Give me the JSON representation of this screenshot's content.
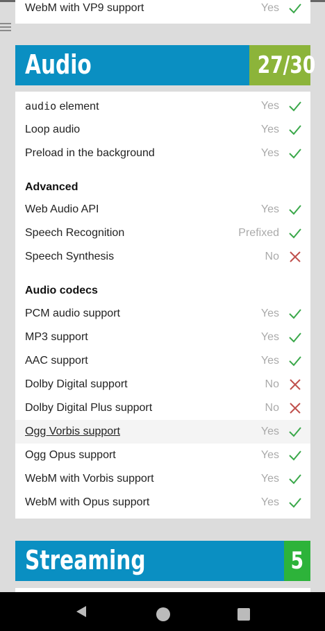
{
  "previous_row": {
    "name": "WebM with VP9 support",
    "result": "Yes",
    "status": "pass"
  },
  "audio": {
    "title": "Audio",
    "score": "27/30",
    "score_color": "#8cb43a",
    "header_color": "#0a8fc2",
    "rows": [
      {
        "name": "audio",
        "name_suffix": " element",
        "result": "Yes",
        "status": "pass"
      },
      {
        "name": "Loop audio",
        "result": "Yes",
        "status": "pass"
      },
      {
        "name": "Preload in the background",
        "result": "Yes",
        "status": "pass"
      }
    ],
    "advanced": {
      "label": "Advanced",
      "rows": [
        {
          "name": "Web Audio API",
          "result": "Yes",
          "status": "pass"
        },
        {
          "name": "Speech Recognition",
          "result": "Prefixed",
          "status": "pass"
        },
        {
          "name": "Speech Synthesis",
          "result": "No",
          "status": "fail"
        }
      ]
    },
    "codecs": {
      "label": "Audio codecs",
      "rows": [
        {
          "name": "PCM audio support",
          "result": "Yes",
          "status": "pass"
        },
        {
          "name": "MP3 support",
          "result": "Yes",
          "status": "pass"
        },
        {
          "name": "AAC support",
          "result": "Yes",
          "status": "pass"
        },
        {
          "name": "Dolby Digital support",
          "result": "No",
          "status": "fail"
        },
        {
          "name": "Dolby Digital Plus support",
          "result": "No",
          "status": "fail"
        },
        {
          "name": "Ogg Vorbis support",
          "result": "Yes",
          "status": "pass",
          "highlighted": true
        },
        {
          "name": "Ogg Opus support",
          "result": "Yes",
          "status": "pass"
        },
        {
          "name": "WebM with Vorbis support",
          "result": "Yes",
          "status": "pass"
        },
        {
          "name": "WebM with Opus support",
          "result": "Yes",
          "status": "pass"
        }
      ]
    }
  },
  "streaming": {
    "title": "Streaming",
    "score": "5",
    "score_color": "#2db33a",
    "header_color": "#0a8fc2"
  },
  "icons": {
    "menu": "hamburger-menu-icon",
    "pass": "check-icon",
    "fail": "cross-icon",
    "nav_back": "back-triangle-icon",
    "nav_home": "home-circle-icon",
    "nav_recent": "recent-apps-square-icon"
  },
  "colors": {
    "pass": "#3aa84a",
    "fail": "#c0504d"
  }
}
